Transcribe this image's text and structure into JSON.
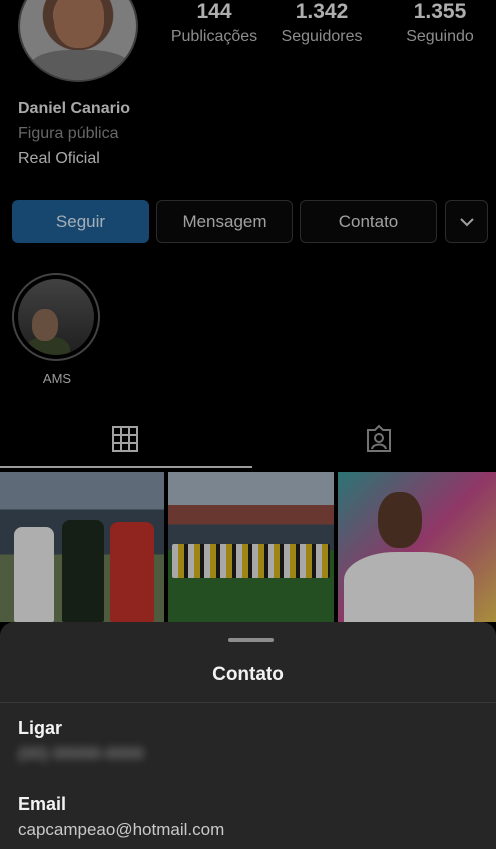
{
  "profile": {
    "name": "Daniel Canario",
    "category": "Figura pública",
    "bio": "Real Oficial"
  },
  "stats": [
    {
      "value": "144",
      "label": "Publicações"
    },
    {
      "value": "1.342",
      "label": "Seguidores"
    },
    {
      "value": "1.355",
      "label": "Seguindo"
    }
  ],
  "actions": {
    "follow": "Seguir",
    "message": "Mensagem",
    "contact": "Contato",
    "more_icon": "chevron-down-icon"
  },
  "highlights": [
    {
      "label": "AMS"
    }
  ],
  "tabs": {
    "grid_icon": "grid-icon",
    "tagged_icon": "tagged-icon",
    "active": "grid"
  },
  "colors": {
    "accent": "#1f5f95",
    "background": "#000000",
    "sheet": "#262626"
  },
  "sheet": {
    "title": "Contato",
    "call_label": "Ligar",
    "call_value": "(00) 00000-0000",
    "email_label": "Email",
    "email_value": "capcampeao@hotmail.com"
  }
}
